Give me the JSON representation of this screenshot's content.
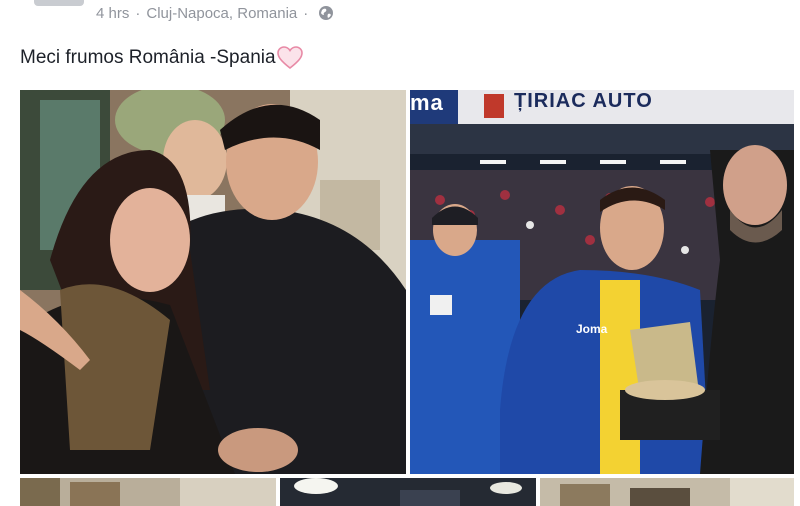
{
  "post": {
    "time": "4 hrs",
    "separator": "·",
    "location": "Cluj-Napoca, Romania",
    "privacy_icon": "globe-icon",
    "text": "Meci frumos România -Spania",
    "emoji": "pink-heart-icon"
  },
  "photos": {
    "photo2": {
      "banner_left": "ma",
      "banner_main": "ȚIRIAC AUTO",
      "jersey_brand": "Joma"
    }
  },
  "colors": {
    "meta_text": "#90949c",
    "post_text": "#1d2129",
    "heart": "#f0a0b8",
    "banner": "#1b2b5c",
    "jacket": "#1f49a8"
  }
}
